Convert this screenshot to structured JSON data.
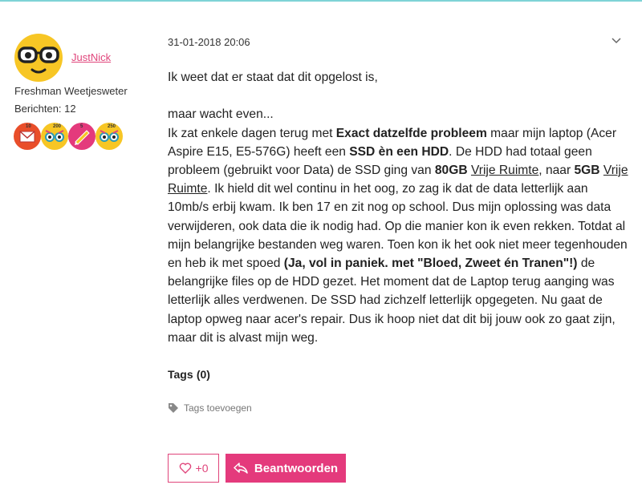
{
  "author": {
    "username": "JustNick",
    "rank": "Freshman Weetjesweter",
    "posts_count": "Berichten: 12",
    "badges": [
      {
        "icon": "mail-badge-icon",
        "count": "10"
      },
      {
        "icon": "glasses-badge-icon",
        "count": "200"
      },
      {
        "icon": "writing-badge-icon",
        "count": "5"
      },
      {
        "icon": "glasses-badge-icon",
        "count": "250"
      }
    ]
  },
  "post": {
    "timestamp": "31-01-2018 20:06",
    "p1": "Ik weet dat er staat dat dit opgelost is,",
    "p2": "maar wacht even...",
    "s1": "Ik zat enkele dagen terug met ",
    "b1": "Exact datzelfde probleem",
    "s2": " maar mijn laptop (Acer Aspire E15, E5-576G) heeft een ",
    "b2": "SSD èn een HDD",
    "s3": ". De HDD had totaal geen probleem (gebruikt voor Data) de SSD ging van ",
    "b3": "80GB",
    "s4": " ",
    "u1": "Vrije Ruimte",
    "s5": ", naar ",
    "b4": "5GB",
    "s6": " ",
    "u2": "Vrije Ruimte",
    "s7": ". Ik hield dit wel continu in het oog, zo zag ik dat de data letterlijk aan 10mb/s erbij kwam. Ik ben 17 en zit nog op school. Dus mijn oplossing was data verwijderen, ook data die ik nodig had. Op die manier kon ik even rekken. Totdat al mijn belangrijke bestanden weg waren. Toen kon ik het ook niet meer tegenhouden en heb ik met spoed ",
    "b5": "(Ja, vol in paniek. met \"Bloed, Zweet én Tranen\"!)",
    "s8": "  de belangrijke files op de HDD gezet. Het moment dat de Laptop terug aanging was letterlijk alles verdwenen. De SSD had zichzelf letterlijk opgegeten. Nu gaat de laptop opweg naar acer's repair. Dus ik hoop niet dat dit bij jouw ook zo gaat zijn, maar dit is alvast mijn weg."
  },
  "tags": {
    "title": "Tags",
    "count": "(0)",
    "add_label": "Tags toevoegen"
  },
  "actions": {
    "like_label": "+0",
    "reply_label": "Beantwoorden"
  },
  "colors": {
    "accent": "#e43a7c",
    "link": "#e0457b",
    "top_border": "#7fd3d6"
  }
}
